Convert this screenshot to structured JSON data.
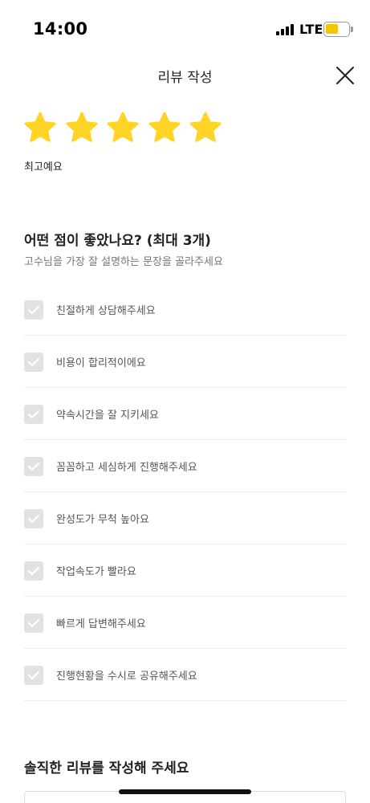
{
  "status": {
    "time": "14:00",
    "network": "LTE",
    "battery_color": "#f7c500"
  },
  "header": {
    "title": "리뷰 작성",
    "close_icon": "close-icon"
  },
  "rating": {
    "stars": 5,
    "max": 5,
    "label": "최고예요",
    "star_color": "#ffd426"
  },
  "section": {
    "title": "어떤 점이 좋았나요? (최대 3개)",
    "subtitle": "고수님을 가장 잘 설명하는 문장을 골라주세요"
  },
  "options": [
    {
      "label": "친절하게 상담해주세요",
      "checked": false
    },
    {
      "label": "비용이 합리적이에요",
      "checked": false
    },
    {
      "label": "약속시간을 잘 지키세요",
      "checked": false
    },
    {
      "label": "꼼꼼하고 세심하게 진행해주세요",
      "checked": false
    },
    {
      "label": "완성도가 무척 높아요",
      "checked": false
    },
    {
      "label": "작업속도가 빨라요",
      "checked": false
    },
    {
      "label": "빠르게 답변해주세요",
      "checked": false
    },
    {
      "label": "진행현황을 수시로 공유해주세요",
      "checked": false
    }
  ],
  "review": {
    "title": "솔직한 리뷰를 작성해 주세요"
  }
}
